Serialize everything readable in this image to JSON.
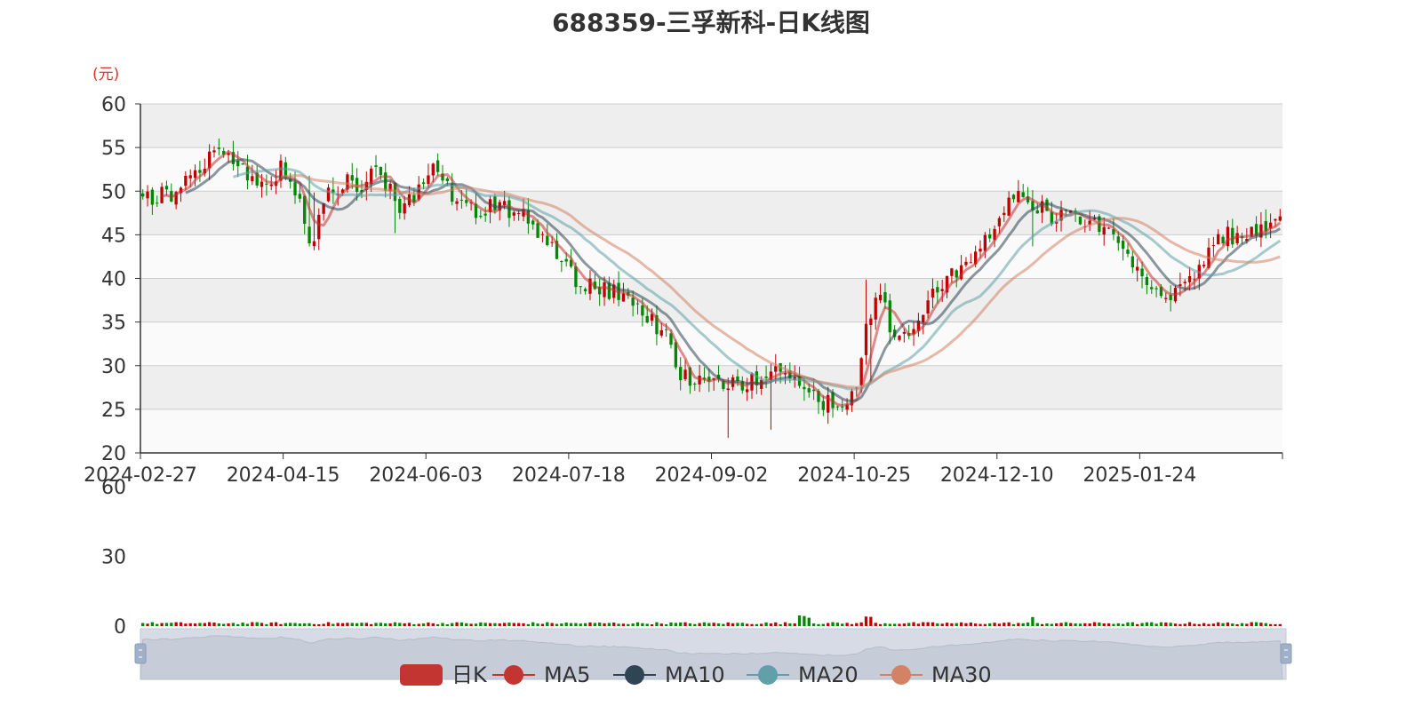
{
  "chart_data": {
    "type": "candlestick",
    "title": "688359-三孚新科-日K线图",
    "unit_label": "(元)",
    "y_axis": {
      "ylim": [
        20,
        60
      ],
      "ticks": [
        60,
        55,
        50,
        45,
        40,
        35,
        30,
        25,
        20
      ]
    },
    "volume_axis": {
      "ticks": [
        60,
        30,
        0
      ]
    },
    "x_axis": {
      "tick_labels": [
        "2024-02-27",
        "2024-04-15",
        "2024-06-03",
        "2024-07-18",
        "2024-09-02",
        "2024-10-25",
        "2024-12-10",
        "2025-01-24"
      ]
    },
    "grid": true,
    "plot_background_bands": [
      "#eeeeee",
      "#fafafa"
    ],
    "legend": {
      "placement": "bottom-center",
      "items": [
        {
          "name": "日K",
          "color": "#c23531",
          "symbol": "roundRect"
        },
        {
          "name": "MA5",
          "color": "#c23531",
          "symbol": "circle"
        },
        {
          "name": "MA10",
          "color": "#2f4554",
          "symbol": "circle"
        },
        {
          "name": "MA20",
          "color": "#61a0a8",
          "symbol": "circle"
        },
        {
          "name": "MA30",
          "color": "#d48265",
          "symbol": "circle"
        }
      ]
    },
    "colors": {
      "up": "#c00000",
      "down": "#008800",
      "ma5": "#c23531",
      "ma10": "#2f4554",
      "ma20": "#61a0a8",
      "ma30": "#d48265"
    },
    "trading_days": 240,
    "price_path": [
      [
        0,
        49
      ],
      [
        7,
        50
      ],
      [
        12,
        53
      ],
      [
        18,
        54
      ],
      [
        24,
        51
      ],
      [
        28,
        50
      ],
      [
        31,
        53
      ],
      [
        34,
        50
      ],
      [
        37,
        44
      ],
      [
        40,
        49
      ],
      [
        45,
        51
      ],
      [
        48,
        50
      ],
      [
        51,
        52
      ],
      [
        55,
        50
      ],
      [
        57,
        48
      ],
      [
        60,
        49
      ],
      [
        64,
        54
      ],
      [
        66,
        51
      ],
      [
        70,
        48
      ],
      [
        74,
        48
      ],
      [
        79,
        48
      ],
      [
        85,
        47
      ],
      [
        90,
        44
      ],
      [
        95,
        40
      ],
      [
        100,
        39
      ],
      [
        106,
        38
      ],
      [
        110,
        36
      ],
      [
        115,
        34
      ],
      [
        119,
        29
      ],
      [
        125,
        28
      ],
      [
        129,
        28
      ],
      [
        135,
        28
      ],
      [
        139,
        29
      ],
      [
        145,
        28
      ],
      [
        150,
        26
      ],
      [
        155,
        26
      ],
      [
        158,
        29
      ],
      [
        160,
        36
      ],
      [
        163,
        38
      ],
      [
        166,
        33
      ],
      [
        170,
        34
      ],
      [
        174,
        38
      ],
      [
        178,
        40
      ],
      [
        183,
        43
      ],
      [
        188,
        46
      ],
      [
        192,
        50
      ],
      [
        196,
        49
      ],
      [
        200,
        47
      ],
      [
        204,
        47
      ],
      [
        208,
        47
      ],
      [
        212,
        46
      ],
      [
        216,
        43
      ],
      [
        220,
        40
      ],
      [
        224,
        38
      ],
      [
        228,
        38
      ],
      [
        232,
        40
      ],
      [
        236,
        44
      ],
      [
        240,
        45
      ],
      [
        244,
        45
      ],
      [
        248,
        46
      ],
      [
        251,
        48
      ]
    ],
    "spikes": [
      [
        37,
        10
      ],
      [
        38,
        9
      ],
      [
        38,
        10
      ],
      [
        56,
        3
      ],
      [
        129,
        5
      ],
      [
        139,
        5
      ],
      [
        160,
        8
      ],
      [
        161,
        6
      ],
      [
        196,
        4
      ]
    ],
    "volume_spikes": [
      [
        145,
        2.5
      ],
      [
        146,
        2.0
      ],
      [
        147,
        1.8
      ],
      [
        160,
        2.0
      ],
      [
        161,
        1.6
      ],
      [
        196,
        1.5
      ]
    ],
    "ma_windows": [
      5,
      10,
      20,
      30
    ]
  }
}
